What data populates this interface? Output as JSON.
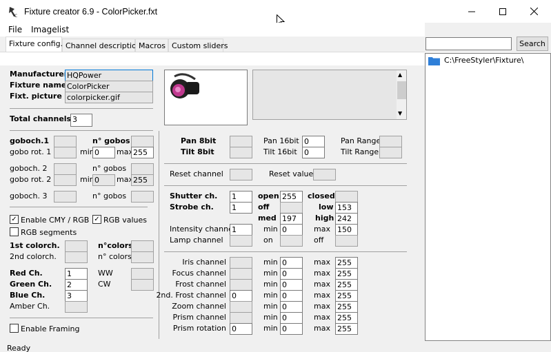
{
  "window": {
    "title": "Fixture creator 6.9 - ColorPicker.fxt",
    "min": "─",
    "max": "☐",
    "close": "✕"
  },
  "menu": [
    "File",
    "Imagelist"
  ],
  "tabs": [
    "Fixture config.",
    "Channel description",
    "Macros",
    "Custom sliders"
  ],
  "search": {
    "button": "Search",
    "value": ""
  },
  "tree": {
    "path": "C:\\FreeStyler\\Fixture\\"
  },
  "fixture": {
    "manufacturer_label": "Manufacturer",
    "manufacturer": "HQPower",
    "name_label": "Fixture name",
    "name": "ColorPicker",
    "picture_label": "Fixt. picture",
    "picture": "colorpicker.gif",
    "total_label": "Total channels",
    "total": "3"
  },
  "gobo": {
    "ch1": "goboch.1",
    "rot1": "gobo rot. 1",
    "ch2": "goboch. 2",
    "rot2": "gobo rot. 2",
    "ch3": "goboch. 3",
    "n_gobos_bold": "n° gobos",
    "n_gobos": "n° gobos",
    "min": "min",
    "max": "max",
    "min_val": "0",
    "max_val": "255"
  },
  "color": {
    "cmy": "Enable CMY / RGB",
    "rgb_values": "RGB values",
    "rgb_segments": "RGB segments",
    "first": "1st colorch.",
    "second": "2nd colorch.",
    "ncolors_bold": "n°colors",
    "ncolors": "n° colors",
    "red": "Red Ch.",
    "red_val": "1",
    "green": "Green Ch.",
    "green_val": "2",
    "blue": "Blue Ch.",
    "blue_val": "3",
    "amber": "Amber Ch.",
    "ww": "WW",
    "cw": "CW",
    "framing": "Enable Framing",
    "check": "✓"
  },
  "pantilt": {
    "pan8": "Pan 8bit",
    "tilt8": "Tilt 8bit",
    "pan16": "Pan 16bit",
    "tilt16": "Tilt 16bit",
    "pan16_val": "0",
    "tilt16_val": "0",
    "pan_range": "Pan Range",
    "tilt_range": "Tilt Range"
  },
  "reset": {
    "channel": "Reset channel",
    "value": "Reset value"
  },
  "shutter": {
    "shutter": "Shutter ch.",
    "shutter_val": "1",
    "strobe": "Strobe ch.",
    "strobe_val": "1",
    "open": "open",
    "open_val": "255",
    "closed": "closed",
    "off": "off",
    "low": "low",
    "low_val": "153",
    "med": "med",
    "med_val": "197",
    "high": "high",
    "high_val": "242",
    "intensity": "Intensity channel",
    "intensity_val": "1",
    "lamp": "Lamp channel",
    "min": "min",
    "min_val": "0",
    "max": "max",
    "max_val": "150",
    "on": "on",
    "off2": "off"
  },
  "channels": [
    {
      "label": "Iris channel",
      "val": "",
      "min": "0",
      "max": "255"
    },
    {
      "label": "Focus channel",
      "val": "",
      "min": "0",
      "max": "255"
    },
    {
      "label": "Frost channel",
      "val": "",
      "min": "0",
      "max": "255"
    },
    {
      "label": "2nd. Frost channel",
      "val": "0",
      "min": "0",
      "max": "255"
    },
    {
      "label": "Zoom channel",
      "val": "",
      "min": "0",
      "max": "255"
    },
    {
      "label": "Prism channel",
      "val": "",
      "min": "0",
      "max": "255"
    },
    {
      "label": "Prism rotation",
      "val": "0",
      "min": "0",
      "max": "255"
    }
  ],
  "ch_min": "min",
  "ch_max": "max",
  "status": "Ready",
  "colors": {
    "folder": "#2f7fd8",
    "titlebar": "#ffffff"
  }
}
